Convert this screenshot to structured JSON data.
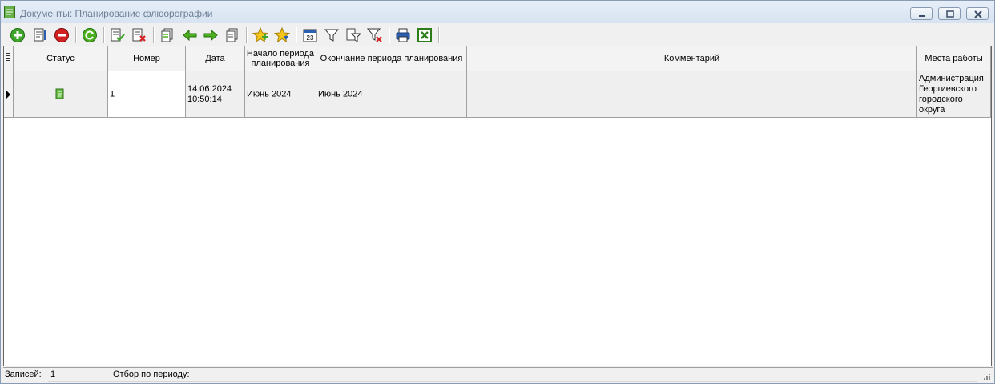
{
  "window": {
    "title": "Документы: Планирование флюорографии"
  },
  "toolbar": {
    "icons": [
      "add-icon",
      "edit-document-icon",
      "delete-icon",
      "refresh-icon",
      "document-check-icon",
      "document-cancel-icon",
      "document-copy-icon",
      "arrow-left-icon",
      "arrow-right-icon",
      "document-move-icon",
      "star-add-icon",
      "star-down-icon",
      "calendar-icon",
      "filter-icon",
      "filter-edit-icon",
      "filter-clear-icon",
      "print-icon",
      "excel-export-icon"
    ],
    "calendar_label": "23"
  },
  "table": {
    "columns": [
      "Статус",
      "Номер",
      "Дата",
      "Начало периода планирования",
      "Окончание периода планирования",
      "Комментарий",
      "Места работы"
    ],
    "rows": [
      {
        "status_icon": "document-green-icon",
        "number": "1",
        "date": "14.06.2024\n10:50:14",
        "period_start": "Июнь 2024",
        "period_end": "Июнь 2024",
        "comment": "",
        "workplaces": "Администрация Георгиевского городского округа"
      }
    ]
  },
  "statusbar": {
    "records_label": "Записей:",
    "records_count": "1",
    "period_filter_label": "Отбор по периоду:",
    "period_filter_value": ""
  },
  "colors": {
    "accent_green": "#4caf1f",
    "delete_red": "#d32020",
    "title_text": "#6d7f96"
  }
}
